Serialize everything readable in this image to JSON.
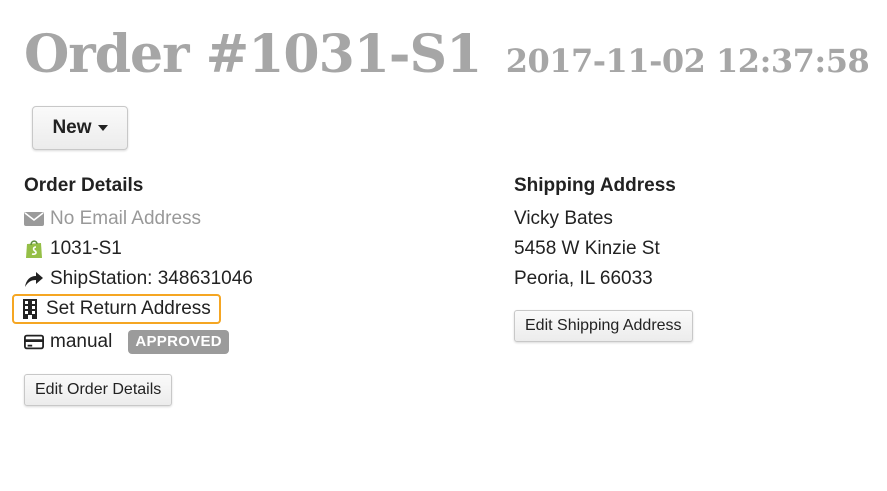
{
  "header": {
    "order_title": "Order #1031-S1",
    "order_datetime": "2017-11-02 12:37:58"
  },
  "toolbar": {
    "new_label": "New"
  },
  "order_details": {
    "title": "Order Details",
    "email": "No Email Address",
    "store_order": "1031-S1",
    "shipstation": "ShipStation: 348631046",
    "return_address": "Set Return Address",
    "payment_method": "manual",
    "payment_status": "APPROVED",
    "edit_label": "Edit Order Details"
  },
  "shipping_address": {
    "title": "Shipping Address",
    "name": "Vicky Bates",
    "street": "5458 W Kinzie St",
    "city_state_zip": "Peoria, IL 66033",
    "edit_label": "Edit Shipping Address"
  },
  "icons": {
    "email": "envelope-icon",
    "store": "shopify-bag-icon",
    "shipstation": "share-arrow-icon",
    "return": "building-icon",
    "payment": "credit-card-icon"
  },
  "colors": {
    "title_gray": "#a6a6a6",
    "highlight_orange": "#f5a623",
    "badge_gray": "#9b9b9b",
    "shopify_green": "#95bf47"
  }
}
